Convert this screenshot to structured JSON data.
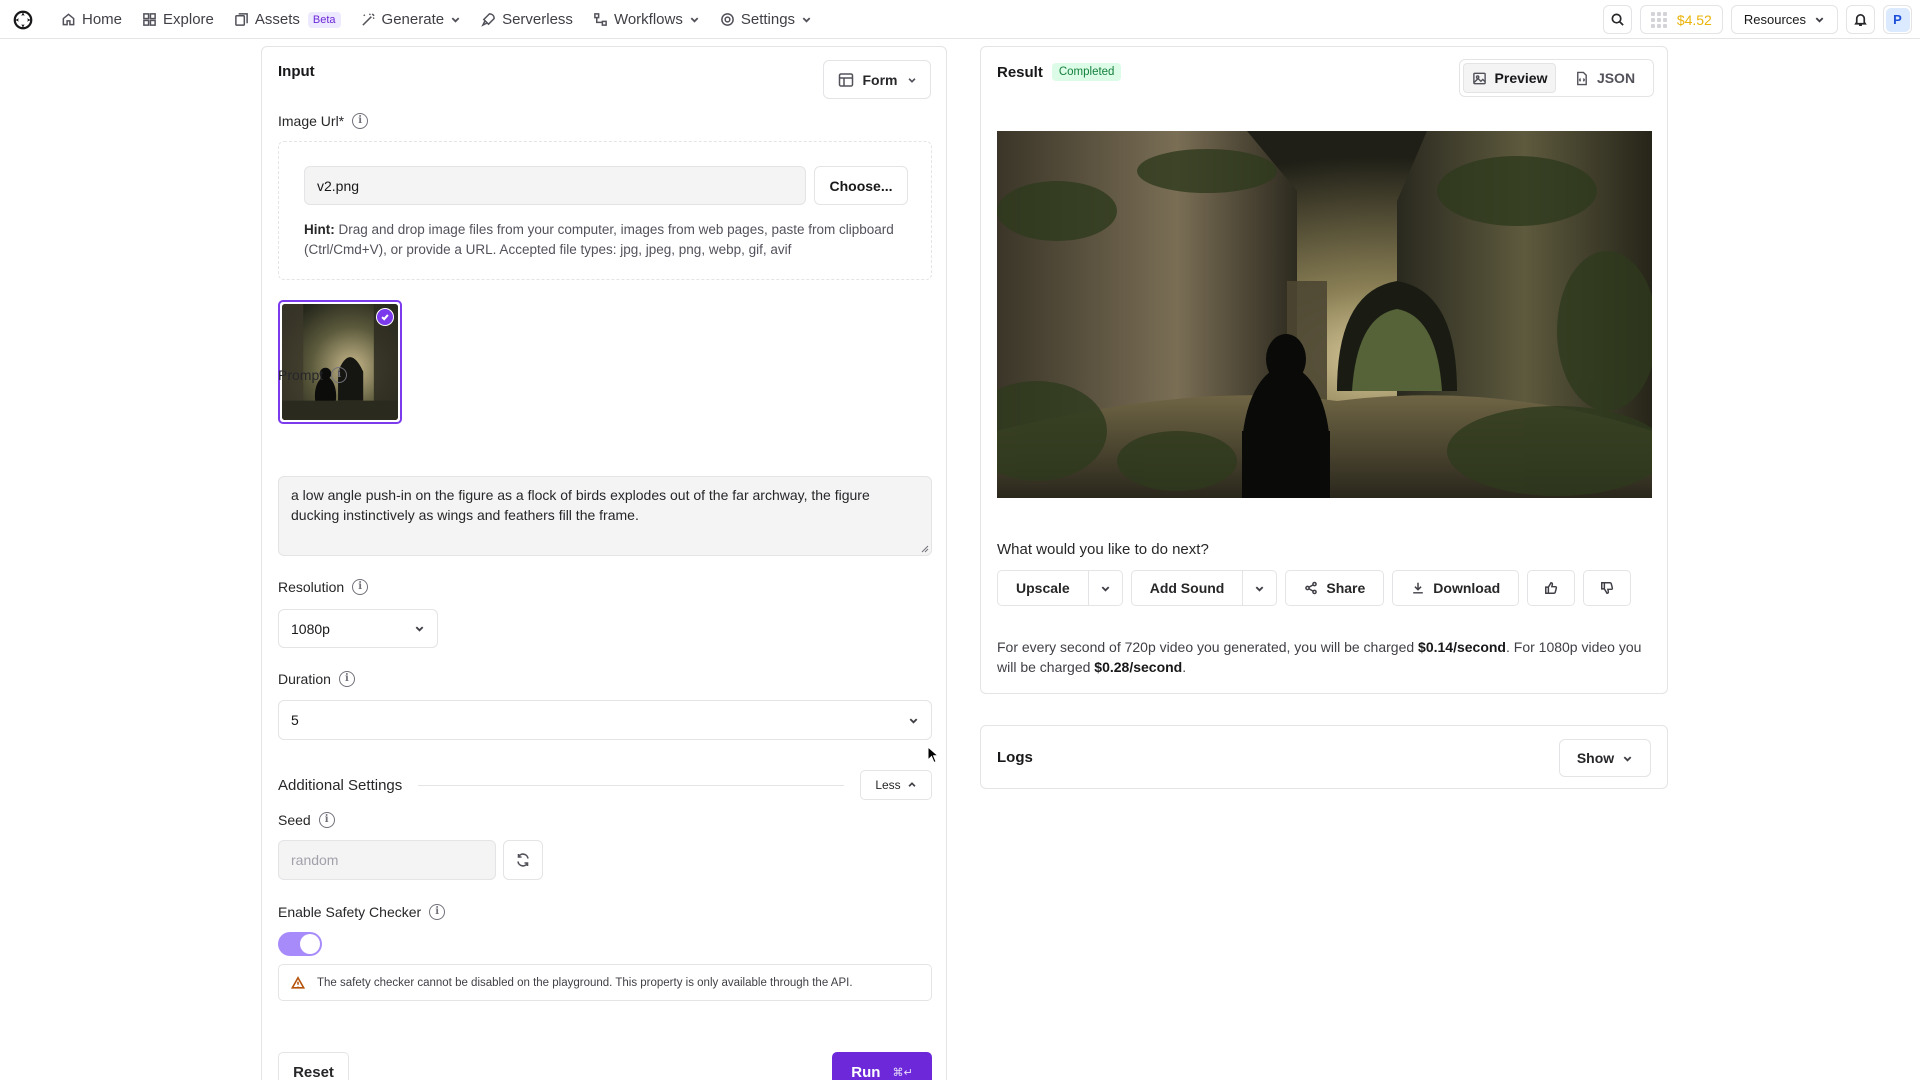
{
  "nav": {
    "items": [
      {
        "label": "Home",
        "icon": "home-icon"
      },
      {
        "label": "Explore",
        "icon": "grid-icon"
      },
      {
        "label": "Assets",
        "icon": "assets-icon",
        "badge": "Beta"
      },
      {
        "label": "Generate",
        "icon": "wand-icon",
        "dropdown": true
      },
      {
        "label": "Serverless",
        "icon": "rocket-icon"
      },
      {
        "label": "Workflows",
        "icon": "workflow-icon",
        "dropdown": true
      },
      {
        "label": "Settings",
        "icon": "gear-icon",
        "dropdown": true
      }
    ],
    "credits": "$4.52",
    "resources_label": "Resources",
    "avatar_initial": "P"
  },
  "input": {
    "title": "Input",
    "mode_label": "Form",
    "image_url": {
      "label": "Image Url*",
      "value": "v2.png",
      "choose_label": "Choose...",
      "hint_bold": "Hint:",
      "hint_text": " Drag and drop image files from your computer, images from web pages, paste from clipboard (Ctrl/Cmd+V), or provide a URL. Accepted file types: jpg, jpeg, png, webp, gif, avif"
    },
    "prompt": {
      "label": "Prompt",
      "value": "a low angle push-in on the figure as a flock of birds explodes out of the far archway, the figure ducking instinctively as wings and feathers fill the frame."
    },
    "resolution": {
      "label": "Resolution",
      "value": "1080p"
    },
    "duration": {
      "label": "Duration",
      "value": "5"
    },
    "additional": {
      "title": "Additional Settings",
      "toggle_label": "Less"
    },
    "seed": {
      "label": "Seed",
      "placeholder": "random"
    },
    "safety": {
      "label": "Enable Safety Checker",
      "enabled": true,
      "warning": "The safety checker cannot be disabled on the playground. This property is only available through the API."
    },
    "reset_label": "Reset",
    "run_label": "Run",
    "run_shortcut": "⌘↵"
  },
  "result": {
    "title": "Result",
    "status": "Completed",
    "views": [
      "Preview",
      "JSON"
    ],
    "active_view": "Preview",
    "next_question": "What would you like to do next?",
    "actions": {
      "upscale": "Upscale",
      "add_sound": "Add Sound",
      "share": "Share",
      "download": "Download"
    },
    "pricing": {
      "p1": "For every second of 720p video you generated, you will be charged ",
      "b1": "$0.14/second",
      "p2": ". For 1080p video you will be charged ",
      "b2": "$0.28/second",
      "p3": "."
    }
  },
  "logs": {
    "title": "Logs",
    "show_label": "Show"
  },
  "colors": {
    "accent": "#6d28d9",
    "success_bg": "#dcfce7",
    "success_text": "#15803d",
    "credits": "#eab308"
  }
}
